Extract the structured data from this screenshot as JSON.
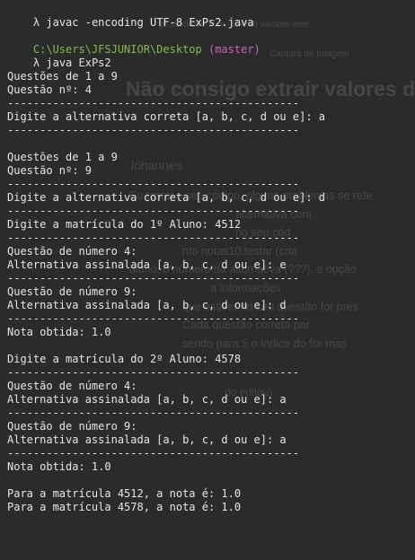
{
  "background_window": {
    "title": "Não consigo extrair valores de",
    "author": "lohannes",
    "body_lines": [
      "Eu testei o seu código, alguns problemas se refe",
      "                                  alternativa com",
      "                                  no seu cód",
      "                 nto notas10.testar (cria",
      "aluno, o número da alternativa (???), a opção",
      "                          a informações",
      "                 que estiver no seu questão for pres",
      "                 Cada questão correta par",
      "                 sendo para 5 o índice do for mas"
    ],
    "edit_link": "do editou)",
    "tab1": "pt.stackoverflow - Extrair valores dele",
    "tab2": "Captura de Imagem"
  },
  "terminal": {
    "prompt_symbol": "λ",
    "cmd1": "javac -encoding UTF-8 ExPs2.java",
    "path": "C:\\Users\\JFSJUNIOR\\Desktop",
    "branch": "(master)",
    "cmd2": "java ExPs2",
    "separator": "---------------------------------------------",
    "q_range": "Questões de 1 a 9",
    "q1_number": "Questão nº: 4",
    "prompt_answer_1": "Digite a alternativa correta [a, b, c, d ou e]: a",
    "q2_number": "Questão nº: 9",
    "prompt_answer_2": "Digite a alternativa correta [a, b, c, d ou e]: d",
    "student1_matricula": "Digite a matrícula do 1º Aluno: 4512",
    "s1_q4_title": "Questão de número 4:",
    "s1_q4_answer": "Alternativa assinalada [a, b, c, d ou e]: e",
    "s1_q9_title": "Questão de número 9:",
    "s1_q9_answer": "Alternativa assinalada [a, b, c, d ou e]: d",
    "s1_grade": "Nota obtida: 1.0",
    "student2_matricula": "Digite a matrícula do 2º Aluno: 4578",
    "s2_q4_title": "Questão de número 4:",
    "s2_q4_answer": "Alternativa assinalada [a, b, c, d ou e]: a",
    "s2_q9_title": "Questão de número 9:",
    "s2_q9_answer": "Alternativa assinalada [a, b, c, d ou e]: a",
    "s2_grade": "Nota obtida: 1.0",
    "summary1": "Para a matrícula 4512, a nota é: 1.0",
    "summary2": "Para a matrícula 4578, a nota é: 1.0"
  },
  "colors": {
    "background": "#2b2b2b",
    "text": "#e6e6e6",
    "path": "#84b84e",
    "branch": "#d05ec3"
  }
}
